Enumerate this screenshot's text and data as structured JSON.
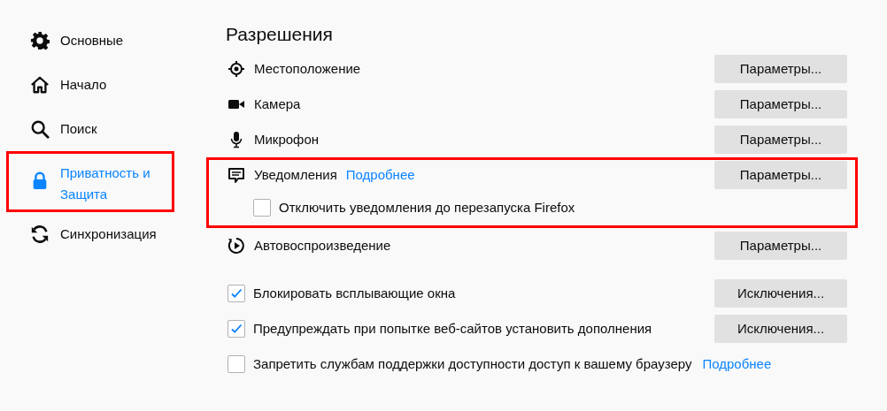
{
  "sidebar": {
    "items": [
      {
        "kind": "gear",
        "label": "Основные",
        "selected": false,
        "highlighted": false
      },
      {
        "kind": "home",
        "label": "Начало",
        "selected": false,
        "highlighted": false
      },
      {
        "kind": "search",
        "label": "Поиск",
        "selected": false,
        "highlighted": false
      },
      {
        "kind": "lock",
        "label": "Приватность и Защита",
        "selected": true,
        "highlighted": true
      },
      {
        "kind": "sync",
        "label": "Синхронизация",
        "selected": false,
        "highlighted": false
      }
    ]
  },
  "permissions": {
    "title": "Разрешения",
    "items": [
      {
        "kind": "location",
        "label": "Местоположение",
        "button": "Параметры...",
        "highlighted": false
      },
      {
        "kind": "camera",
        "label": "Камера",
        "button": "Параметры...",
        "highlighted": false
      },
      {
        "kind": "microphone",
        "label": "Микрофон",
        "button": "Параметры...",
        "highlighted": false
      },
      {
        "kind": "notifications",
        "label": "Уведомления",
        "link": "Подробнее",
        "button": "Параметры...",
        "highlighted": true,
        "option": {
          "label": "Отключить уведомления до перезапуска Firefox",
          "checked": false
        }
      },
      {
        "kind": "autoplay",
        "label": "Автовоспроизведение",
        "button": "Параметры...",
        "highlighted": false
      }
    ]
  },
  "options": [
    {
      "label": "Блокировать всплывающие окна",
      "checked": true,
      "button": "Исключения..."
    },
    {
      "label": "Предупреждать при попытке веб-сайтов установить дополнения",
      "checked": true,
      "button": "Исключения..."
    },
    {
      "label": "Запретить службам поддержки доступности доступ к вашему браузеру",
      "checked": false,
      "link": "Подробнее"
    }
  ]
}
